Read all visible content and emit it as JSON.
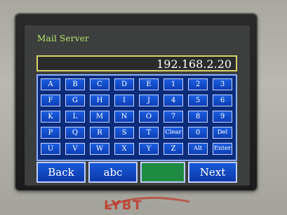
{
  "screen_title": "Mail Server",
  "ip_value": "192.168.2.20",
  "keys": [
    [
      "A",
      "B",
      "C",
      "D",
      "E",
      "1",
      "2",
      "3"
    ],
    [
      "F",
      "G",
      "H",
      "I",
      "J",
      "4",
      "5",
      "6"
    ],
    [
      "K",
      "L",
      "M",
      "N",
      "O",
      "7",
      "8",
      "9"
    ],
    [
      "P",
      "Q",
      "R",
      "S",
      "T",
      "Clear",
      "0",
      "Del"
    ],
    [
      "U",
      "V",
      "W",
      "X",
      "Y",
      "Z",
      "Alt",
      "Enter"
    ]
  ],
  "bottom_buttons": {
    "back": "Back",
    "abc": "abc",
    "next": "Next"
  },
  "logo_text": "LYBT",
  "colors": {
    "title": "#b9e36f",
    "key_blue": "#1b5de0",
    "keypad_bg": "#0b2c7a",
    "ip_border": "#d7d36a",
    "green_button": "#1f8a41",
    "logo_red": "#c0392b"
  }
}
